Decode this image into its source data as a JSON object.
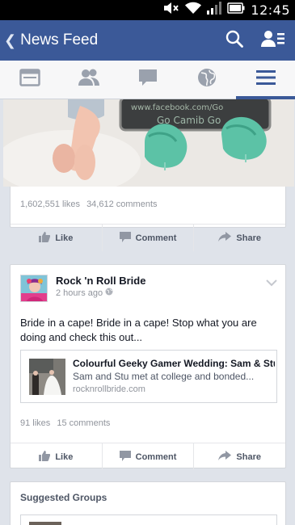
{
  "status_bar": {
    "time": "12:45"
  },
  "action_bar": {
    "back_icon": "chevron-left-icon",
    "title": "News Feed",
    "search_icon": "search-icon",
    "friends_icon": "friend-requests-icon",
    "color": "#3b5998"
  },
  "tabs": [
    {
      "name": "feed",
      "icon": "news-feed-icon"
    },
    {
      "name": "friends",
      "icon": "friends-icon"
    },
    {
      "name": "messages",
      "icon": "messages-icon"
    },
    {
      "name": "notifications",
      "icon": "globe-icon"
    },
    {
      "name": "more",
      "icon": "menu-icon",
      "active": true
    }
  ],
  "post1": {
    "likes": "1,602,551 likes",
    "comments": "34,612 comments",
    "sign_text_1": "www.facebook.com/Go",
    "sign_text_2": "Go Camib Go",
    "actions": {
      "like": "Like",
      "comment": "Comment",
      "share": "Share"
    }
  },
  "post2": {
    "author": "Rock 'n Roll Bride",
    "time": "2 hours ago",
    "text": "Bride in a cape! Bride in a cape! Stop what you are doing and check this out...",
    "link": {
      "title": "Colourful Geeky Gamer Wedding: Sam & Stu",
      "description": "Sam and Stu met at college and bonded...",
      "domain": "rocknrollbride.com"
    },
    "likes": "91 likes",
    "comments": "15 comments",
    "actions": {
      "like": "Like",
      "comment": "Comment",
      "share": "Share"
    }
  },
  "suggested": {
    "title": "Suggested Groups"
  }
}
